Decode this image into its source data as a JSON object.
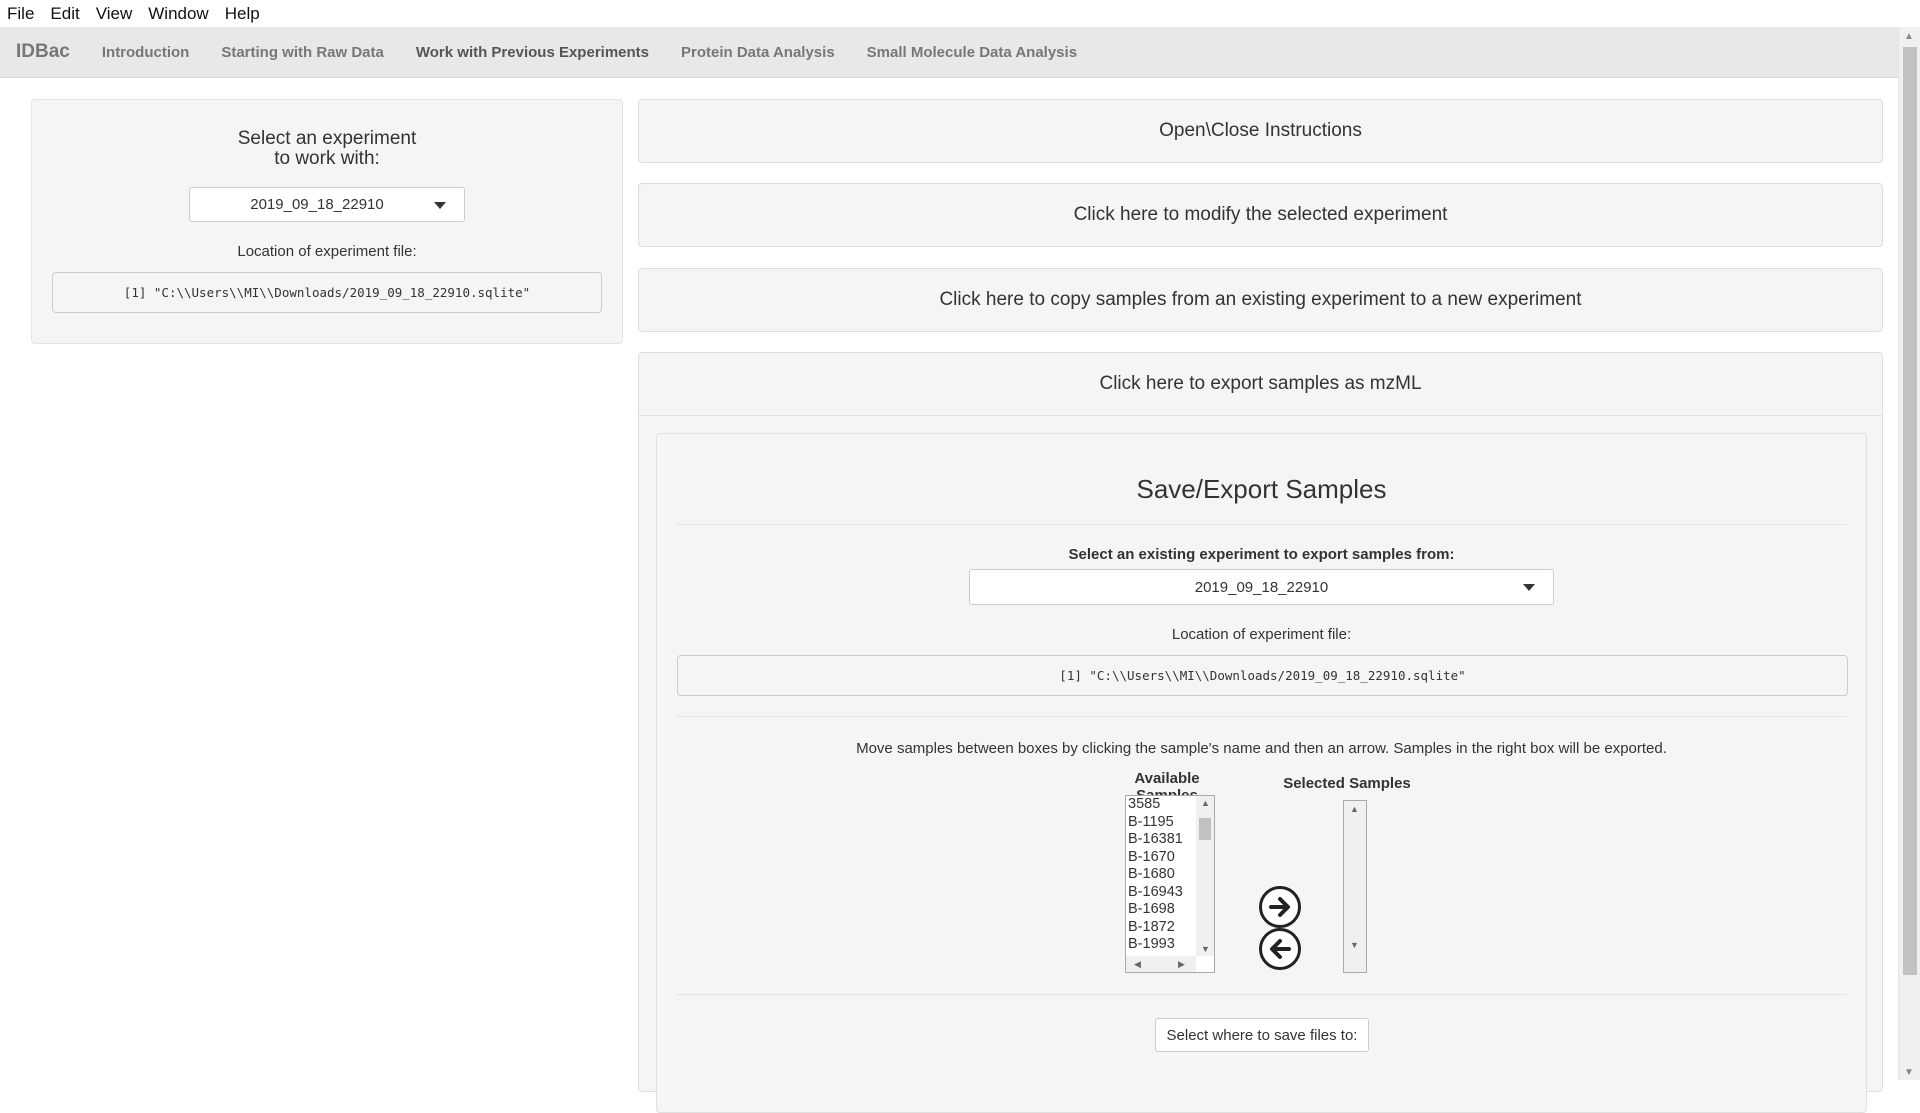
{
  "menubar": {
    "items": [
      "File",
      "Edit",
      "View",
      "Window",
      "Help"
    ]
  },
  "navbar": {
    "brand": "IDBac",
    "links": [
      "Introduction",
      "Starting with Raw Data",
      "Work with Previous Experiments",
      "Protein Data Analysis",
      "Small Molecule Data Analysis"
    ],
    "active_index": 2
  },
  "left": {
    "title_line1": "Select an experiment",
    "title_line2": "to work with:",
    "selected_experiment": "2019_09_18_22910",
    "location_label": "Location of experiment file:",
    "location_value": "[1] \"C:\\\\Users\\\\MI\\\\Downloads/2019_09_18_22910.sqlite\""
  },
  "right": {
    "panel_instructions": "Open\\Close Instructions",
    "panel_modify": "Click here to modify the selected experiment",
    "panel_copy": "Click here to copy samples from an existing experiment to a new experiment",
    "panel_export": "Click here to export samples as mzML",
    "export": {
      "title": "Save/Export Samples",
      "select_label": "Select an existing experiment to export samples from:",
      "selected_experiment": "2019_09_18_22910",
      "location_label": "Location of experiment file:",
      "location_value": "[1] \"C:\\\\Users\\\\MI\\\\Downloads/2019_09_18_22910.sqlite\"",
      "instructions": "Move samples between boxes by clicking the sample's name and then an arrow. Samples in the right box will be exported.",
      "available_label": "Available Samples",
      "selected_label": "Selected Samples",
      "available_samples": [
        "3585",
        "B-1195",
        "B-16381",
        "B-1670",
        "B-1680",
        "B-16943",
        "B-1698",
        "B-1872",
        "B-1993"
      ],
      "save_button": "Select where to save files to:"
    }
  },
  "icons": {
    "add": "arrow-right-circle-icon",
    "remove": "arrow-left-circle-icon"
  }
}
